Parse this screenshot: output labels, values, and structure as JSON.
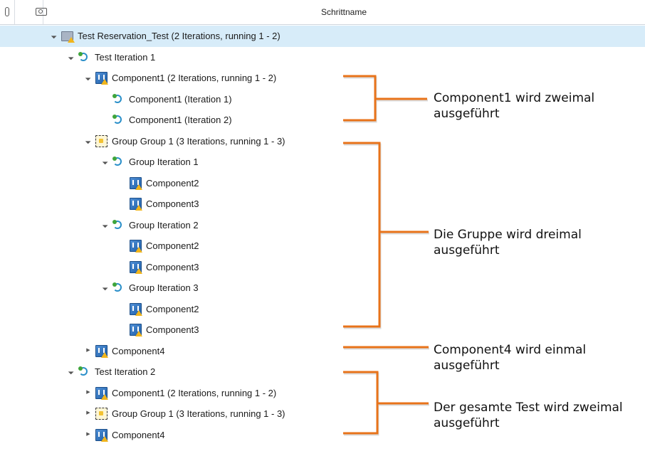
{
  "header": {
    "title": "Schrittname",
    "attachment_icon": "paperclip-icon",
    "screenshot_icon": "camera-icon"
  },
  "tree": [
    {
      "label": "Test Reservation_Test (2 Iterations, running 1 - 2)",
      "icon": "test-folder-icon",
      "expand": "expanded",
      "depth": 0,
      "selected": true
    },
    {
      "label": "Test Iteration 1",
      "icon": "iteration-icon",
      "expand": "expanded",
      "depth": 1
    },
    {
      "label": "Component1 (2 Iterations, running 1 - 2)",
      "icon": "component-icon",
      "expand": "expanded",
      "depth": 2
    },
    {
      "label": "Component1 (Iteration 1)",
      "icon": "iteration-icon",
      "expand": "none",
      "depth": 3
    },
    {
      "label": "Component1 (Iteration 2)",
      "icon": "iteration-icon",
      "expand": "none",
      "depth": 3
    },
    {
      "label": "Group Group 1 (3 Iterations, running 1 - 3)",
      "icon": "group-icon",
      "expand": "expanded",
      "depth": 2
    },
    {
      "label": "Group Iteration 1",
      "icon": "iteration-icon",
      "expand": "expanded",
      "depth": 3
    },
    {
      "label": "Component2",
      "icon": "component-icon",
      "expand": "none",
      "depth": 4
    },
    {
      "label": "Component3",
      "icon": "component-icon",
      "expand": "none",
      "depth": 4
    },
    {
      "label": "Group Iteration 2",
      "icon": "iteration-icon",
      "expand": "expanded",
      "depth": 3
    },
    {
      "label": "Component2",
      "icon": "component-icon",
      "expand": "none",
      "depth": 4
    },
    {
      "label": "Component3",
      "icon": "component-icon",
      "expand": "none",
      "depth": 4
    },
    {
      "label": "Group Iteration 3",
      "icon": "iteration-icon",
      "expand": "expanded",
      "depth": 3
    },
    {
      "label": "Component2",
      "icon": "component-icon",
      "expand": "none",
      "depth": 4
    },
    {
      "label": "Component3",
      "icon": "component-icon",
      "expand": "none",
      "depth": 4
    },
    {
      "label": "Component4",
      "icon": "component-icon",
      "expand": "collapsed",
      "depth": 2
    },
    {
      "label": "Test Iteration 2",
      "icon": "iteration-icon",
      "expand": "expanded",
      "depth": 1
    },
    {
      "label": "Component1 (2 Iterations, running 1 - 2)",
      "icon": "component-icon",
      "expand": "collapsed",
      "depth": 2
    },
    {
      "label": "Group Group 1 (3 Iterations, running 1 - 3)",
      "icon": "group-icon",
      "expand": "collapsed",
      "depth": 2
    },
    {
      "label": "Component4",
      "icon": "component-icon",
      "expand": "collapsed",
      "depth": 2
    }
  ],
  "annotations": [
    {
      "line1": "Component1 wird zweimal",
      "line2": "ausgeführt"
    },
    {
      "line1": "Die Gruppe wird dreimal",
      "line2": "ausgeführt"
    },
    {
      "line1": "Component4 wird einmal",
      "line2": "ausgeführt"
    },
    {
      "line1": "Der gesamte Test wird zweimal",
      "line2": "ausgeführt"
    }
  ],
  "colors": {
    "selection": "#d7ecf9",
    "annotation_bracket": "#e8731a"
  }
}
